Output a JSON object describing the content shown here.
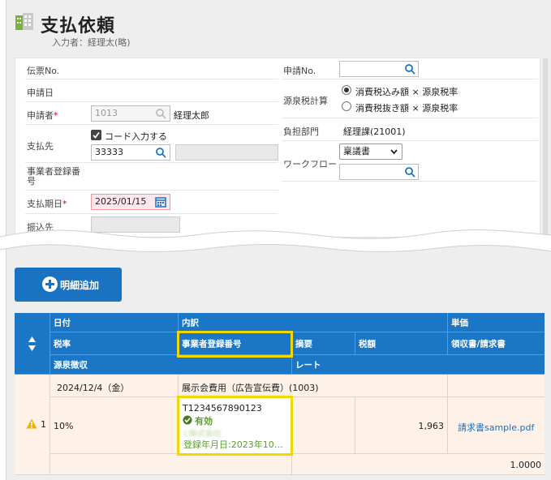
{
  "header": {
    "title": "支払依頼",
    "subtitle": "入力者：経理太(略)"
  },
  "form": {
    "left": {
      "denpyo_label": "伝票No.",
      "shinsei_bi_label": "申請日",
      "shinseisha_label": "申請者",
      "shinseisha_code": "1013",
      "shinseisha_name": "経理太郎",
      "shiharaisaki_label": "支払先",
      "code_input_label": "コード入力する",
      "shiharaisaki_code": "33333",
      "jigyousha_label": "事業者登録番号",
      "kijitsu_label": "支払期日",
      "kijitsu_value": "2025/01/15",
      "furikomi_label": "振込先"
    },
    "right": {
      "shinsei_no_label": "申請No.",
      "gensen_label": "源泉税計算",
      "radio1": "消費税込み額 × 源泉税率",
      "radio2": "消費税抜き額 × 源泉税率",
      "futan_label": "負担部門",
      "futan_value": "経理課(21001)",
      "workflow_label": "ワークフロー",
      "workflow_selected": "稟議書"
    }
  },
  "add_button": {
    "label": "明細追加"
  },
  "table": {
    "headers_row1": [
      "日付",
      "内訳",
      "単価"
    ],
    "headers_row2": [
      "税率",
      "事業者登録番号",
      "摘要",
      "税額",
      "領収書/請求書"
    ],
    "headers_row3": [
      "源泉徴収",
      "レート"
    ],
    "row": {
      "index": "1",
      "date": "2024/12/4（金）",
      "breakdown": "展示会費用（広告宣伝費）(1003)",
      "tax_rate": "10%",
      "reg_number": "T1234567890123",
      "status": "有効",
      "company_name": "C株式会社",
      "reg_date": "登録年月日:2023年10…",
      "tax_amount": "1,963",
      "receipt_link": "請求書sample.pdf",
      "rate": "1.0000"
    }
  },
  "colors": {
    "accent": "#1b76c6",
    "highlight": "#f1d800",
    "status_green": "#5aa02c"
  }
}
